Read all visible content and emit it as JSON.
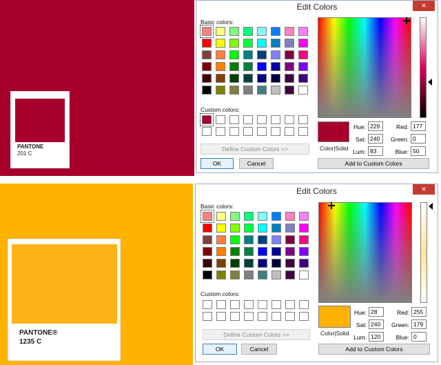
{
  "panels": [
    {
      "id": "top",
      "background_color": "#a8002c",
      "pantone": {
        "brand": "PANTONE",
        "code": "201 C",
        "color": "#a8002c"
      },
      "dialog": {
        "title": "Edit Colors",
        "close_label": "×",
        "basic_colors_label": "Basic colors:",
        "custom_colors_label": "Custom colors:",
        "define_custom_label": "Define Custom Colors >>",
        "ok_label": "OK",
        "cancel_label": "Cancel",
        "add_custom_label": "Add to Custom Colors",
        "color_solid_label": "Color|Solid",
        "preview_color": "#a8002c",
        "lum_bar_top": "#ffffff",
        "lum_bar_mid": "#e0005a",
        "lum_bar_bottom": "#000000",
        "fields": {
          "hue_label": "Hue:",
          "hue": "229",
          "sat_label": "Sat:",
          "sat": "240",
          "lum_label": "Lum:",
          "lum": "83",
          "red_label": "Red:",
          "red": "177",
          "green_label": "Green:",
          "green": "0",
          "blue_label": "Blue:",
          "blue": "50"
        },
        "selected_basic_index": 0,
        "custom_colors": [
          "#a8002c",
          "#ffffff",
          "#ffffff",
          "#ffffff",
          "#ffffff",
          "#ffffff",
          "#ffffff",
          "#ffffff",
          "#ffffff",
          "#ffffff",
          "#ffffff",
          "#ffffff",
          "#ffffff",
          "#ffffff",
          "#ffffff",
          "#ffffff"
        ],
        "selected_custom_index": 0
      }
    },
    {
      "id": "bottom",
      "background_color": "#ffb300",
      "pantone": {
        "brand": "PANTONE®",
        "code": "1235 C",
        "color": "#ffb118"
      },
      "dialog": {
        "title": "Edit Colors",
        "close_label": "×",
        "basic_colors_label": "Basic colors:",
        "custom_colors_label": "Custom colors:",
        "define_custom_label": "Define Custom Colors >>",
        "ok_label": "OK",
        "cancel_label": "Cancel",
        "add_custom_label": "Add to Custom Colors",
        "color_solid_label": "Color|Solid",
        "preview_color": "#ffb300",
        "lum_bar_top": "#ffffff",
        "lum_bar_mid": "#ffe39a",
        "lum_bar_bottom": "#ffffff",
        "fields": {
          "hue_label": "Hue:",
          "hue": "28",
          "sat_label": "Sat:",
          "sat": "240",
          "lum_label": "Lum:",
          "lum": "120",
          "red_label": "Red:",
          "red": "255",
          "green_label": "Green:",
          "green": "179",
          "blue_label": "Blue:",
          "blue": "0"
        },
        "selected_basic_index": 0,
        "custom_colors": [
          "#ffffff",
          "#ffffff",
          "#ffffff",
          "#ffffff",
          "#ffffff",
          "#ffffff",
          "#ffffff",
          "#ffffff",
          "#ffffff",
          "#ffffff",
          "#ffffff",
          "#ffffff",
          "#ffffff",
          "#ffffff",
          "#ffffff",
          "#ffffff"
        ],
        "selected_custom_index": -1
      }
    }
  ],
  "basic_colors": [
    "#ff8080",
    "#ffff80",
    "#80ff80",
    "#00ff80",
    "#80ffff",
    "#0080ff",
    "#ff80c0",
    "#ff80ff",
    "#ff0000",
    "#ffff00",
    "#80ff00",
    "#00ff40",
    "#00ffff",
    "#0080c0",
    "#8080c0",
    "#ff00ff",
    "#804040",
    "#ff8040",
    "#00ff00",
    "#008080",
    "#004080",
    "#8080ff",
    "#800040",
    "#ff0080",
    "#800000",
    "#ff8000",
    "#008000",
    "#008040",
    "#0000ff",
    "#0000a0",
    "#800080",
    "#8000ff",
    "#400000",
    "#804000",
    "#004000",
    "#004040",
    "#000080",
    "#000040",
    "#400040",
    "#400080",
    "#000000",
    "#808000",
    "#808040",
    "#808080",
    "#408080",
    "#c0c0c0",
    "#400040",
    "#ffffff"
  ]
}
